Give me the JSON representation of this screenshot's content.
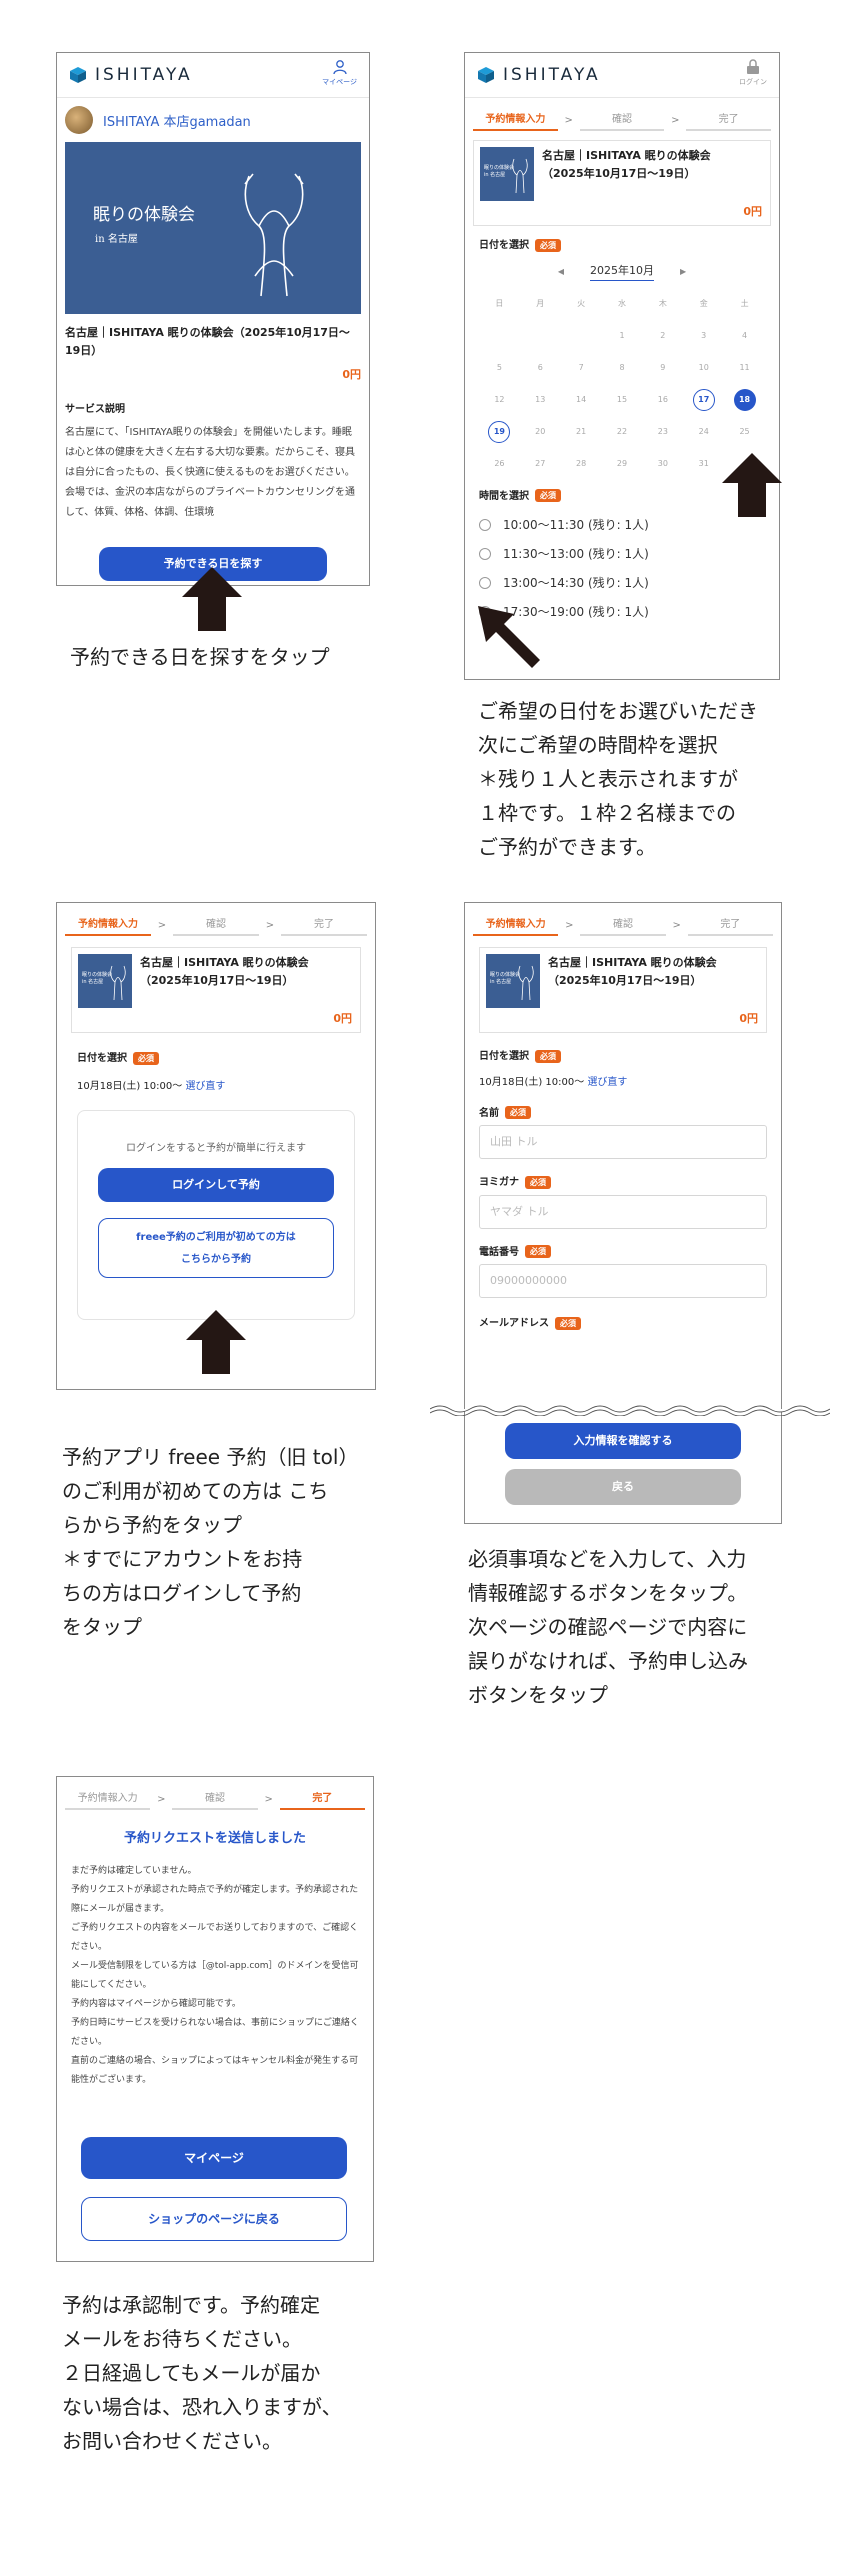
{
  "brand": {
    "logo_text": "ISHITAYA",
    "mypage_label": "マイページ",
    "login_label": "ログイン"
  },
  "shop": {
    "name": "ISHITAYA 本店gamadan"
  },
  "event": {
    "title_full": "名古屋｜ISHITAYA 眠りの体験会（2025年10月17日〜19日）",
    "title_short_1": "名古屋｜ISHITAYA 眠りの体験会",
    "title_short_2": "（2025年10月17日〜19日）",
    "price": "0円",
    "hero_title": "眠りの体験会",
    "hero_sub": "in 名古屋",
    "thumb_text": "眠りの体験会 in 名古屋"
  },
  "screen1": {
    "service_heading": "サービス説明",
    "service_text": "名古屋にて、「ISHITAYA眠りの体験会」を開催いたします。睡眠は心と体の健康を大きく左右する大切な要素。だからこそ、寝具は自分に合ったもの、長く快適に使えるものをお選びください。会場では、金沢の本店ながらのプライベートカウンセリングを通して、体質、体格、体調、住環境",
    "find_button": "予約できる日を探す"
  },
  "steps": {
    "input": "予約情報入力",
    "confirm": "確認",
    "done": "完了",
    "sep": ">"
  },
  "labels": {
    "select_date": "日付を選択",
    "select_time": "時間を選択",
    "required": "必須"
  },
  "calendar": {
    "month": "2025年10月",
    "prev": "◀",
    "next": "▶",
    "weekdays": [
      "日",
      "月",
      "火",
      "水",
      "木",
      "金",
      "土"
    ],
    "days": [
      "",
      "",
      "",
      "1",
      "2",
      "3",
      "4",
      "5",
      "6",
      "7",
      "8",
      "9",
      "10",
      "11",
      "12",
      "13",
      "14",
      "15",
      "16",
      "17",
      "18",
      "19",
      "20",
      "21",
      "22",
      "23",
      "24",
      "25",
      "26",
      "27",
      "28",
      "29",
      "30",
      "31",
      ""
    ],
    "available": [
      "17",
      "18",
      "19"
    ],
    "selected": "18"
  },
  "timeslots": [
    "10:00〜11:30 (残り: 1人)",
    "11:30〜13:00 (残り: 1人)",
    "13:00〜14:30 (残り: 1人)",
    "17:30〜19:00 (残り: 1人)"
  ],
  "screen3": {
    "date_value": "10月18日(土) 10:00〜",
    "reselect": "選び直す",
    "login_hint": "ログインをすると予約が簡単に行えます",
    "login_button": "ログインして予約",
    "new_button_1": "freee予約のご利用が初めての方は",
    "new_button_2": "こちらから予約"
  },
  "screen4": {
    "name_label": "名前",
    "name_placeholder": "山田 トル",
    "kana_label": "ヨミガナ",
    "kana_placeholder": "ヤマダ トル",
    "phone_label": "電話番号",
    "phone_placeholder": "09000000000",
    "email_label": "メールアドレス",
    "confirm_button": "入力情報を確認する",
    "back_button": "戻る"
  },
  "screen5": {
    "heading": "予約リクエストを送信しました",
    "body": "まだ予約は確定していません。\n予約リクエストが承認された時点で予約が確定します。予約承認された際にメールが届きます。\nご予約リクエストの内容をメールでお送りしておりますので、ご確認ください。\nメール受信制限をしている方は［@tol-app.com］のドメインを受信可能にしてください。\n予約内容はマイページから確認可能です。\n予約日時にサービスを受けられない場合は、事前にショップにご連絡ください。\n直前のご連絡の場合、ショップによってはキャンセル料金が発生する可能性がございます。",
    "mypage_button": "マイページ",
    "shop_button": "ショップのページに戻る"
  },
  "captions": {
    "c1": "予約できる日を探すをタップ",
    "c2": "ご希望の日付をお選びいただき\n次にご希望の時間枠を選択\n＊残り１人と表示されますが\n１枠です。１枠２名様までの\nご予約ができます。",
    "c3": "予約アプリ freee 予約（旧 tol）\nのご利用が初めての方は こち\nらから予約をタップ\n＊すでにアカウントをお持\nちの方はログインして予約\nをタップ",
    "c4": "必須事項などを入力して、入力\n情報確認するボタンをタップ。\n次ページの確認ページで内容に\n誤りがなければ、予約申し込み\nボタンをタップ",
    "c5": "予約は承認制です。予約確定\nメールをお待ちください。\n２日経過してもメールが届か\nない場合は、恐れ入りますが、\nお問い合わせください。"
  },
  "colors": {
    "accent_blue": "#2756c9",
    "accent_orange": "#e8641b",
    "hero_blue": "#3b5e93"
  }
}
